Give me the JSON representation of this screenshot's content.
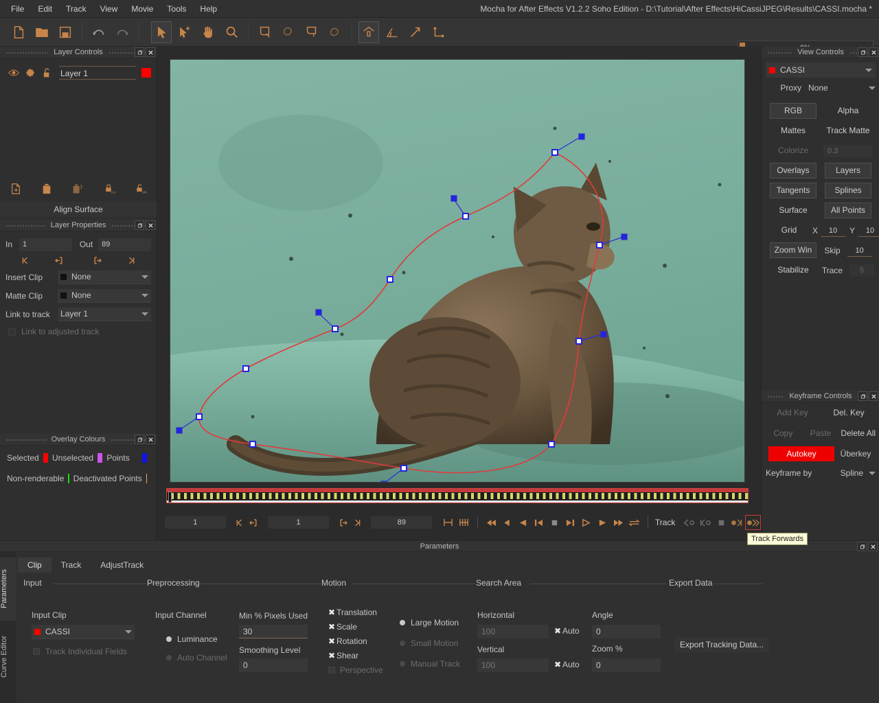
{
  "app": {
    "title": "Mocha for After Effects V1.2.2 Soho Edition - D:\\Tutorial\\After Effects\\HiCassiJPEG\\Results\\CASSI.mocha *"
  },
  "menu": {
    "items": [
      {
        "label": "File"
      },
      {
        "label": "Edit"
      },
      {
        "label": "Track"
      },
      {
        "label": "View"
      },
      {
        "label": "Movie"
      },
      {
        "label": "Tools"
      },
      {
        "label": "Help"
      }
    ]
  },
  "toolbar": {
    "icons": [
      {
        "name": "new-project-icon",
        "active": false
      },
      {
        "name": "open-project-icon",
        "active": false
      },
      {
        "name": "save-project-icon",
        "active": false
      },
      {
        "name": "undo-icon",
        "active": false
      },
      {
        "name": "redo-icon",
        "active": false
      },
      {
        "name": "select-tool-icon",
        "active": true
      },
      {
        "name": "add-point-tool-icon",
        "active": false
      },
      {
        "name": "pan-hand-tool-icon",
        "active": false
      },
      {
        "name": "zoom-tool-icon",
        "active": false
      },
      {
        "name": "create-xspline-layer-icon",
        "active": false
      },
      {
        "name": "add-xspline-icon",
        "active": false
      },
      {
        "name": "create-bezier-layer-icon",
        "active": false
      },
      {
        "name": "add-bezier-icon",
        "active": false
      },
      {
        "name": "show-planar-surface-icon",
        "active": true
      },
      {
        "name": "show-grid-icon",
        "active": false
      },
      {
        "name": "show-trace-icon",
        "active": false
      },
      {
        "name": "align-surface-axis-icon",
        "active": false
      }
    ],
    "progress": {
      "value": "0%",
      "percent": 0
    }
  },
  "layer_controls": {
    "panel_title": "Layer Controls",
    "icons": [
      {
        "name": "visibility-eye-icon"
      },
      {
        "name": "settings-gear-icon"
      },
      {
        "name": "lock-open-icon"
      }
    ],
    "layer_name": "Layer 1",
    "layer_color": "#ff0000",
    "tool_icons": [
      {
        "name": "add-layer-icon"
      },
      {
        "name": "delete-layer-icon"
      },
      {
        "name": "delete-all-layers-icon"
      },
      {
        "name": "lock-all-layers-icon"
      },
      {
        "name": "unlock-all-layers-icon"
      }
    ],
    "align_surface_label": "Align Surface"
  },
  "layer_properties": {
    "panel_title": "Layer Properties",
    "in_label": "In",
    "in_value": "1",
    "out_label": "Out",
    "out_value": "89",
    "nav_icons": [
      {
        "name": "go-to-start-icon"
      },
      {
        "name": "set-in-point-icon"
      },
      {
        "name": "set-out-point-icon"
      },
      {
        "name": "go-to-end-icon"
      }
    ],
    "insert_clip_label": "Insert Clip",
    "insert_clip_value": "None",
    "matte_clip_label": "Matte Clip",
    "matte_clip_value": "None",
    "link_to_track_label": "Link to track",
    "link_to_track_value": "Layer 1",
    "link_adjusted_label": "Link to adjusted track",
    "link_adjusted_checked": false
  },
  "overlay_colours": {
    "panel_title": "Overlay Colours",
    "entries": [
      {
        "label": "Selected",
        "color": "#ff0000",
        "name": "selected-colour-swatch"
      },
      {
        "label": "Unselected",
        "color": "#cc55ee",
        "name": "unselected-colour-swatch"
      },
      {
        "label": "Points",
        "color": "#1111ee",
        "name": "points-colour-swatch"
      },
      {
        "label": "Non-renderable",
        "color": "#11dd11",
        "name": "non-renderable-colour-swatch"
      },
      {
        "label": "Deactivated Points",
        "color": "#f0a858",
        "name": "deactivated-points-colour-swatch"
      }
    ]
  },
  "view_controls": {
    "panel_title": "View Controls",
    "clip_name": "CASSI",
    "clip_color": "#ff0000",
    "proxy_label": "Proxy",
    "proxy_value": "None",
    "rgb_label": "RGB",
    "alpha_label": "Alpha",
    "mattes_label": "Mattes",
    "track_matte_label": "Track Matte",
    "colorize_label": "Colorize",
    "colorize_value": "0.3",
    "overlays_label": "Overlays",
    "layers_label": "Layers",
    "tangents_label": "Tangents",
    "splines_label": "Splines",
    "surface_label": "Surface",
    "all_points_label": "All Points",
    "grid_label": "Grid",
    "grid_x_label": "X",
    "grid_x_value": "10",
    "grid_y_label": "Y",
    "grid_y_value": "10",
    "zoom_win_label": "Zoom Win",
    "skip_label": "Skip",
    "skip_value": "10",
    "stabilize_label": "Stabilize",
    "trace_label": "Trace",
    "trace_value": "5"
  },
  "keyframe_controls": {
    "panel_title": "Keyframe Controls",
    "add_key_label": "Add Key",
    "del_key_label": "Del. Key",
    "copy_label": "Copy",
    "paste_label": "Paste",
    "delete_all_label": "Delete All",
    "autokey_label": "Autokey",
    "autokey_color": "#ee0000",
    "uberkey_label": "Überkey",
    "keyframe_by_label": "Keyframe by",
    "keyframe_by_value": "Spline"
  },
  "timeline": {
    "current_frame": "1",
    "in_frame": "1",
    "out_frame": "89",
    "track_label": "Track",
    "transport_icons": [
      {
        "name": "go-to-start-icon"
      },
      {
        "name": "previous-keyframe-icon"
      },
      {
        "name": "step-back-icon"
      },
      {
        "name": "previous-frame-icon"
      },
      {
        "name": "stop-icon"
      },
      {
        "name": "next-frame-icon"
      },
      {
        "name": "play-reverse-icon"
      },
      {
        "name": "play-icon"
      },
      {
        "name": "fast-forward-icon"
      },
      {
        "name": "loop-icon"
      }
    ],
    "track_icons": [
      {
        "name": "track-backwards-one-icon"
      },
      {
        "name": "track-backwards-icon"
      },
      {
        "name": "stop-tracking-icon"
      },
      {
        "name": "track-forwards-one-icon"
      },
      {
        "name": "track-forwards-icon",
        "highlighted": true
      }
    ],
    "tooltip": "Track Forwards"
  },
  "parameters": {
    "panel_title": "Parameters",
    "vertical_tabs": [
      {
        "label": "Parameters",
        "active": true
      },
      {
        "label": "Curve Editor",
        "active": false
      }
    ],
    "tabs": [
      {
        "label": "Clip",
        "active": true
      },
      {
        "label": "Track",
        "active": false
      },
      {
        "label": "AdjustTrack",
        "active": false
      }
    ],
    "groups": {
      "input": {
        "title": "Input",
        "input_clip_label": "Input Clip",
        "input_clip_value": "CASSI",
        "input_clip_color": "#ff0000",
        "track_individual_fields_label": "Track Individual Fields",
        "track_individual_fields_checked": false
      },
      "preprocessing": {
        "title": "Preprocessing",
        "input_channel_label": "Input Channel",
        "luminance_label": "Luminance",
        "luminance_selected": true,
        "auto_channel_label": "Auto Channel",
        "auto_channel_selected": false,
        "min_pixels_label": "Min % Pixels Used",
        "min_pixels_value": "30",
        "smoothing_label": "Smoothing Level",
        "smoothing_value": "0"
      },
      "motion": {
        "title": "Motion",
        "checks": [
          {
            "label": "Translation",
            "checked": true
          },
          {
            "label": "Scale",
            "checked": true
          },
          {
            "label": "Rotation",
            "checked": true
          },
          {
            "label": "Shear",
            "checked": true
          },
          {
            "label": "Perspective",
            "checked": false
          }
        ],
        "radios": [
          {
            "label": "Large Motion",
            "selected": true
          },
          {
            "label": "Small Motion",
            "selected": false
          },
          {
            "label": "Manual Track",
            "selected": false
          }
        ]
      },
      "search_area": {
        "title": "Search Area",
        "horizontal_label": "Horizontal",
        "horizontal_value": "100",
        "horizontal_auto_label": "Auto",
        "horizontal_auto_checked": true,
        "vertical_label": "Vertical",
        "vertical_value": "100",
        "vertical_auto_label": "Auto",
        "vertical_auto_checked": true,
        "angle_label": "Angle",
        "angle_value": "0",
        "zoom_label": "Zoom %",
        "zoom_value": "0"
      },
      "export": {
        "title": "Export Data",
        "button_label": "Export Tracking Data..."
      }
    }
  }
}
